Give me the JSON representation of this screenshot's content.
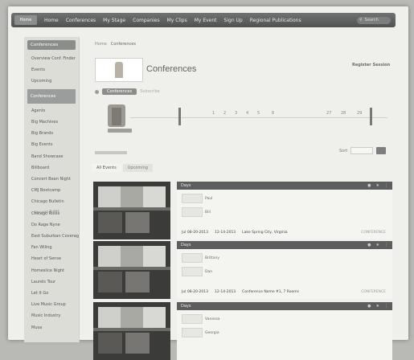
{
  "nav": {
    "logo": "Home",
    "items": [
      "Home",
      "Conferences",
      "My Stage",
      "Companies",
      "My Clips",
      "My Event",
      "Sign Up",
      "Regional Publications"
    ],
    "search_placeholder": "Search"
  },
  "sidebar": {
    "header": "Conferences",
    "items": [
      "Overview Conf. Finder",
      "Events",
      "Upcoming",
      "Conferences",
      "Agents",
      "Big Machines",
      "Big Brands",
      "Big Events",
      "Band Showcase",
      "Billboard",
      "Concert Bean Night",
      "CMJ Bootcamp",
      "Chicago Bulletin",
      "Chicago Rules",
      "Do Rage Nyne",
      "East Suburban Coverage",
      "Fan Wiling",
      "Heart of Sense",
      "Homeslice Night",
      "Laurels Tour",
      "Let It Go",
      "Live Music Group",
      "Music Industry",
      "Musa"
    ],
    "active_index": 3
  },
  "breadcrumb": {
    "home": "Home",
    "current": "Conferences"
  },
  "page_title": "Conferences",
  "register_label": "Register Session",
  "chip": {
    "label": "Conferences",
    "text": "Subscribe"
  },
  "timeline": {
    "ticks": [
      "1",
      "2",
      "3",
      "4",
      "5",
      "6",
      "27",
      "28",
      "29"
    ]
  },
  "sort": {
    "label": "Sort"
  },
  "tabs": [
    "All Events",
    "Upcoming"
  ],
  "cards": [
    {
      "header": "Days",
      "speakers": [
        "Paul",
        "Bill"
      ],
      "meta": [
        "Jul 08-20-2013",
        "12-14-2013",
        "Lake Spring City, Virginia"
      ],
      "meta_right": "CONFERENCE"
    },
    {
      "header": "Days",
      "speakers": [
        "Brittany",
        "Dan"
      ],
      "meta": [
        "Jul 08-20-2013",
        "12-14-2013",
        "Conference Name #1, 7 Rooms"
      ],
      "meta_right": "CONFERENCE"
    },
    {
      "header": "Days",
      "speakers": [
        "Vanessa",
        "Georgia"
      ],
      "meta": [
        "",
        "",
        ""
      ],
      "meta_right": ""
    }
  ],
  "sidebar_tag": "Chicago Rules"
}
